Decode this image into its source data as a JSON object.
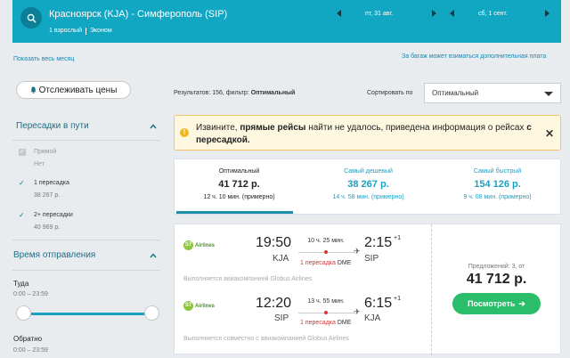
{
  "header": {
    "route": "Красноярск (KJA) - Симферополь (SIP)",
    "passengers": "1 взрослый",
    "class": "Эконом",
    "depart_date": "пт, 31 авг.",
    "return_date": "сб, 1 сент."
  },
  "links": {
    "show_month": "Показать весь месяц",
    "baggage_fee": "За багаж может взиматься дополнительная плата"
  },
  "sidebar": {
    "track_label": "Отслеживать цены",
    "transfers_title": "Пересадки в пути",
    "filters": [
      {
        "label": "Прямой",
        "price": "Нет",
        "checked": true,
        "disabled": true
      },
      {
        "label": "1 пересадка",
        "price": "38 267 р.",
        "checked": true,
        "disabled": false
      },
      {
        "label": "2+ пересадки",
        "price": "40 969 р.",
        "checked": true,
        "disabled": false
      }
    ],
    "departure_title": "Время отправления",
    "there_label": "Туда",
    "there_range": "0:00 – 23:59",
    "back_label": "Обратно",
    "back_range": "0:00 – 23:59"
  },
  "results": {
    "prefix": "Результатов: 156, фильтр:",
    "filter": "Оптимальный",
    "sort_label": "Сортировать по",
    "sort_value": "Оптимальный"
  },
  "notice": {
    "part1": "Извините,",
    "bold1": "прямые рейсы",
    "part2": "найти не удалось, приведена информация о рейсах",
    "bold2": "с пересадкой."
  },
  "tabs": [
    {
      "name": "Оптимальный",
      "price": "41 712 р.",
      "time": "12 ч. 10 мин. (примерно)"
    },
    {
      "name": "Самый дешевый",
      "price": "38 267 р.",
      "time": "14 ч. 58 мин. (примерно)"
    },
    {
      "name": "Самый быстрый",
      "price": "154 126 р.",
      "time": "9 ч. 08 мин. (примерно)"
    }
  ],
  "ticket": {
    "airline": "Airlines",
    "outbound": {
      "dep_time": "19:50",
      "dep_code": "KJA",
      "arr_time": "2:15",
      "arr_sup": "+1",
      "arr_code": "SIP",
      "duration": "10 ч. 25 мин.",
      "transfer": "1 пересадка",
      "transfer_code": "DME",
      "operated": "Выполняется авиакомпанией Globus Airlines"
    },
    "inbound": {
      "dep_time": "12:20",
      "dep_code": "SIP",
      "arr_time": "6:15",
      "arr_sup": "+1",
      "arr_code": "KJA",
      "duration": "13 ч. 55 мин.",
      "transfer": "1 пересадка",
      "transfer_code": "DME",
      "operated": "Выполняется совместно с авиакомпанией Globus Airlines"
    },
    "offers": "Предложений: 3, от",
    "price": "41 712 р.",
    "view_label": "Посмотреть",
    "view_arrow": "➔"
  },
  "colors": {
    "brand": "#11a6c1",
    "accent_dark": "#1b6f87",
    "cta": "#2abd6a",
    "warning": "#f1b71e",
    "transfer_red": "#d93636"
  }
}
